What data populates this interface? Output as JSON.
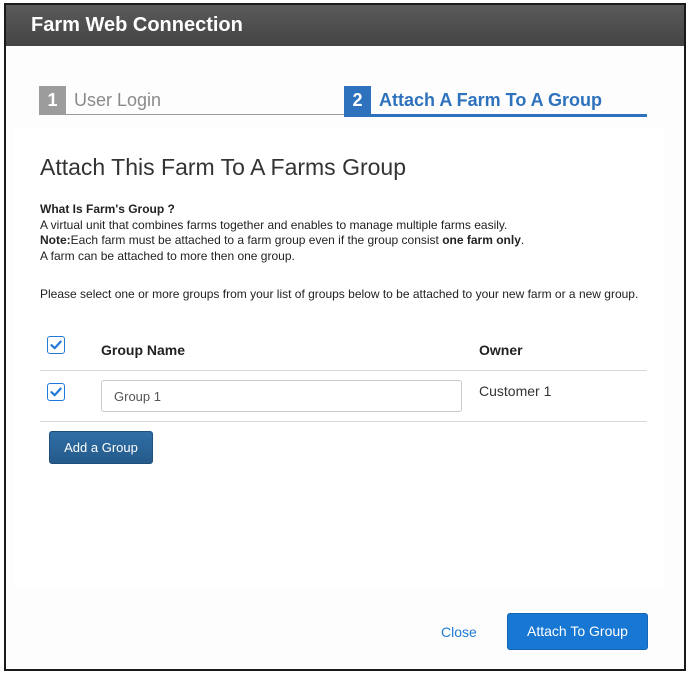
{
  "dialog": {
    "title": "Farm Web Connection"
  },
  "steps": [
    {
      "number": "1",
      "label": "User Login",
      "state": "inactive"
    },
    {
      "number": "2",
      "label": "Attach A Farm To A Group",
      "state": "active"
    }
  ],
  "main": {
    "heading": "Attach This Farm To A Farms Group",
    "info": {
      "question": "What Is Farm's Group ?",
      "line1": "A virtual unit that combines farms together and enables to manage multiple farms easily.",
      "note_label": "Note:",
      "note_text_a": "Each farm must be attached to a farm group even if the group consist ",
      "note_bold": "one farm only",
      "note_text_b": ".",
      "line3": "A farm can be attached to more then one group."
    },
    "instruction": "Please select one or more groups from your list of groups below to be attached to your new farm or a new group.",
    "table": {
      "columns": [
        "Group Name",
        "Owner"
      ],
      "select_all_checked": true,
      "rows": [
        {
          "checked": true,
          "group_name": "Group 1",
          "owner": "Customer 1"
        }
      ]
    },
    "add_group_label": "Add a Group"
  },
  "footer": {
    "close_label": "Close",
    "attach_label": "Attach To Group"
  },
  "colors": {
    "accent": "#1777d2",
    "step_active": "#2e72bd",
    "step_inactive": "#9c9c9c",
    "title_bar": "#4a4a4a"
  }
}
